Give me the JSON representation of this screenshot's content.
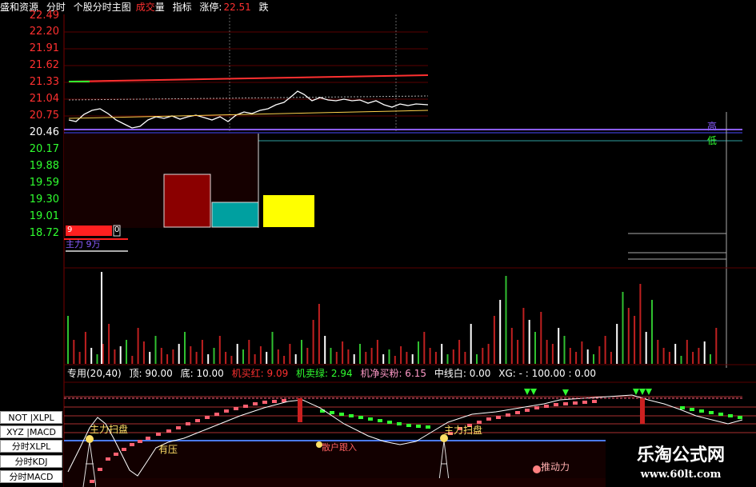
{
  "header": {
    "stock": "盛和资源",
    "view": "分时",
    "chart_name": "个股分时主图",
    "vol_a": "成交",
    "vol_b": "量",
    "indicator": "指标",
    "limit_up_label": "涨停:",
    "limit_up_value": "22.51",
    "limit_down_label": "跌"
  },
  "price_axis": {
    "ticks": [
      "22.49",
      "22.20",
      "21.91",
      "21.62",
      "21.33",
      "21.04",
      "20.75",
      "20.46",
      "20.17",
      "19.88",
      "19.59",
      "19.30",
      "19.01",
      "18.72"
    ],
    "tick_colors": [
      "#ff3030",
      "#ff3030",
      "#ff3030",
      "#ff3030",
      "#ff3030",
      "#ff3030",
      "#ff3030",
      "#ffffff",
      "#30ff30",
      "#30ff30",
      "#30ff30",
      "#30ff30",
      "#30ff30",
      "#30ff30"
    ]
  },
  "right_labels": {
    "high": "高",
    "low": "低"
  },
  "left_panel": {
    "value_a": "9",
    "value_b": "0",
    "fund_label": "主力 9万"
  },
  "indicator_header": {
    "name": "专用(20,40)",
    "top": "顶: 90.00",
    "bottom": "底: 10.00",
    "buy_red": "机买红: 9.09",
    "sell_green": "机卖绿: 2.94",
    "net_buy": "机净买粉: 6.15",
    "mid_line": "中线白: 0.00",
    "xg": "XG: - : 100.00 : 0.00"
  },
  "indicator_labels": {
    "sweep1": "主力扫盘",
    "sweep2": "主力扫盘",
    "pressure": "有压",
    "retail": "散户跟入",
    "drive": "推动力"
  },
  "side_buttons": [
    "NOT |XLPL",
    "XYZ |MACD",
    "分时XLPL",
    "分时KDJ",
    "分时MACD"
  ],
  "watermark": {
    "title": "乐淘公式网",
    "url": "www.60lt.com"
  },
  "colors": {
    "up": "#ff3030",
    "down": "#30ff30",
    "flat": "#ffffff",
    "axis": "#7a0000",
    "accent_purple": "#8a5cff"
  }
}
